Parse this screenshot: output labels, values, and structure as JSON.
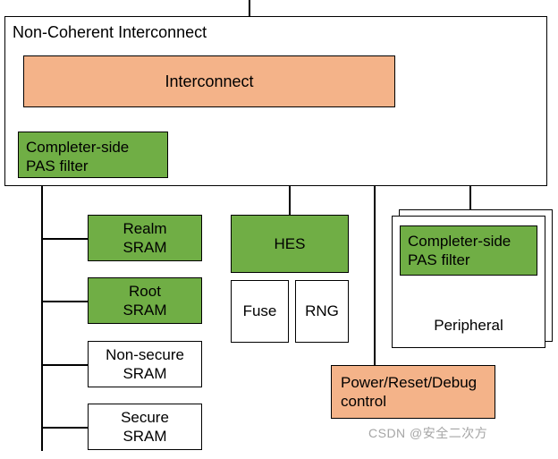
{
  "top": {
    "title": "Non-Coherent Interconnect",
    "interconnect_label": "Interconnect",
    "pas_filter_left": "Completer-side\nPAS filter"
  },
  "left_stack": {
    "realm": "Realm\nSRAM",
    "root": "Root\nSRAM",
    "nonsecure": "Non-secure\nSRAM",
    "secure": "Secure\nSRAM"
  },
  "middle": {
    "hes": "HES",
    "fuse": "Fuse",
    "rng": "RNG",
    "power": "Power/Reset/Debug\ncontrol"
  },
  "right": {
    "pas_filter": "Completer-side\nPAS filter",
    "peripheral": "Peripheral"
  },
  "watermark": "CSDN @安全二次方"
}
